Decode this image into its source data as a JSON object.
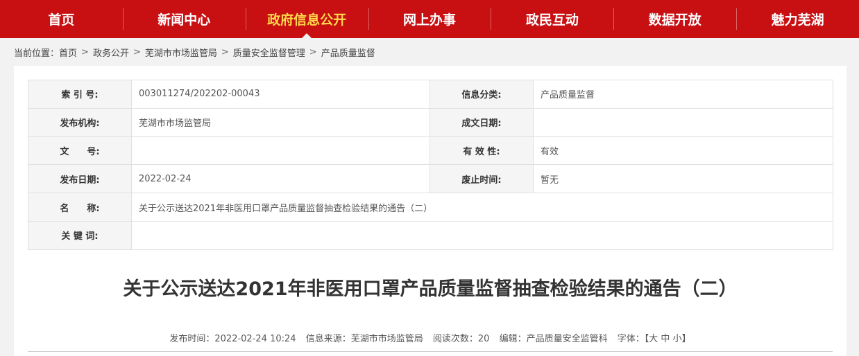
{
  "nav": {
    "items": [
      {
        "label": "首页"
      },
      {
        "label": "新闻中心"
      },
      {
        "label": "政府信息公开"
      },
      {
        "label": "网上办事"
      },
      {
        "label": "政民互动"
      },
      {
        "label": "数据开放"
      },
      {
        "label": "魅力芜湖"
      }
    ],
    "active_index": 2,
    "color": "#c81013",
    "active_color": "#ffd84a"
  },
  "breadcrumb": {
    "prefix": "当前位置：",
    "items": [
      "首页",
      "政务公开",
      "芜湖市市场监管局",
      "质量安全监督管理",
      "产品质量监督"
    ],
    "separator": ">"
  },
  "meta": {
    "rows": [
      {
        "l1": "索 引 号:",
        "v1": "003011274/202202-00043",
        "l2": "信息分类:",
        "v2": "产品质量监督"
      },
      {
        "l1": "发布机构:",
        "v1": "芜湖市市场监管局",
        "l2": "成文日期:",
        "v2": ""
      },
      {
        "l1": "文　　号:",
        "v1": "",
        "l2": "有 效 性:",
        "v2": "有效"
      },
      {
        "l1": "发布日期:",
        "v1": "2022-02-24",
        "l2": "废止时间:",
        "v2": "暂无"
      }
    ],
    "name_label": "名　　称:",
    "name_value": "关于公示送达2021年非医用口罩产品质量监督抽查检验结果的通告（二）",
    "keyword_label": "关 键 词:",
    "keyword_value": ""
  },
  "article": {
    "title": "关于公示送达2021年非医用口罩产品质量监督抽查检验结果的通告（二）",
    "publish_time_label": "发布时间：",
    "publish_time": "2022-02-24 10:24",
    "source_label": "信息来源：",
    "source": "芜湖市市场监管局",
    "views_label": "阅读次数：",
    "views": "20",
    "editor_label": "编辑：",
    "editor": "产品质量安全监管科",
    "font_label": "字体：",
    "font_open": "【",
    "font_large": "大",
    "font_medium": "中",
    "font_small": "小",
    "font_close": "】"
  }
}
